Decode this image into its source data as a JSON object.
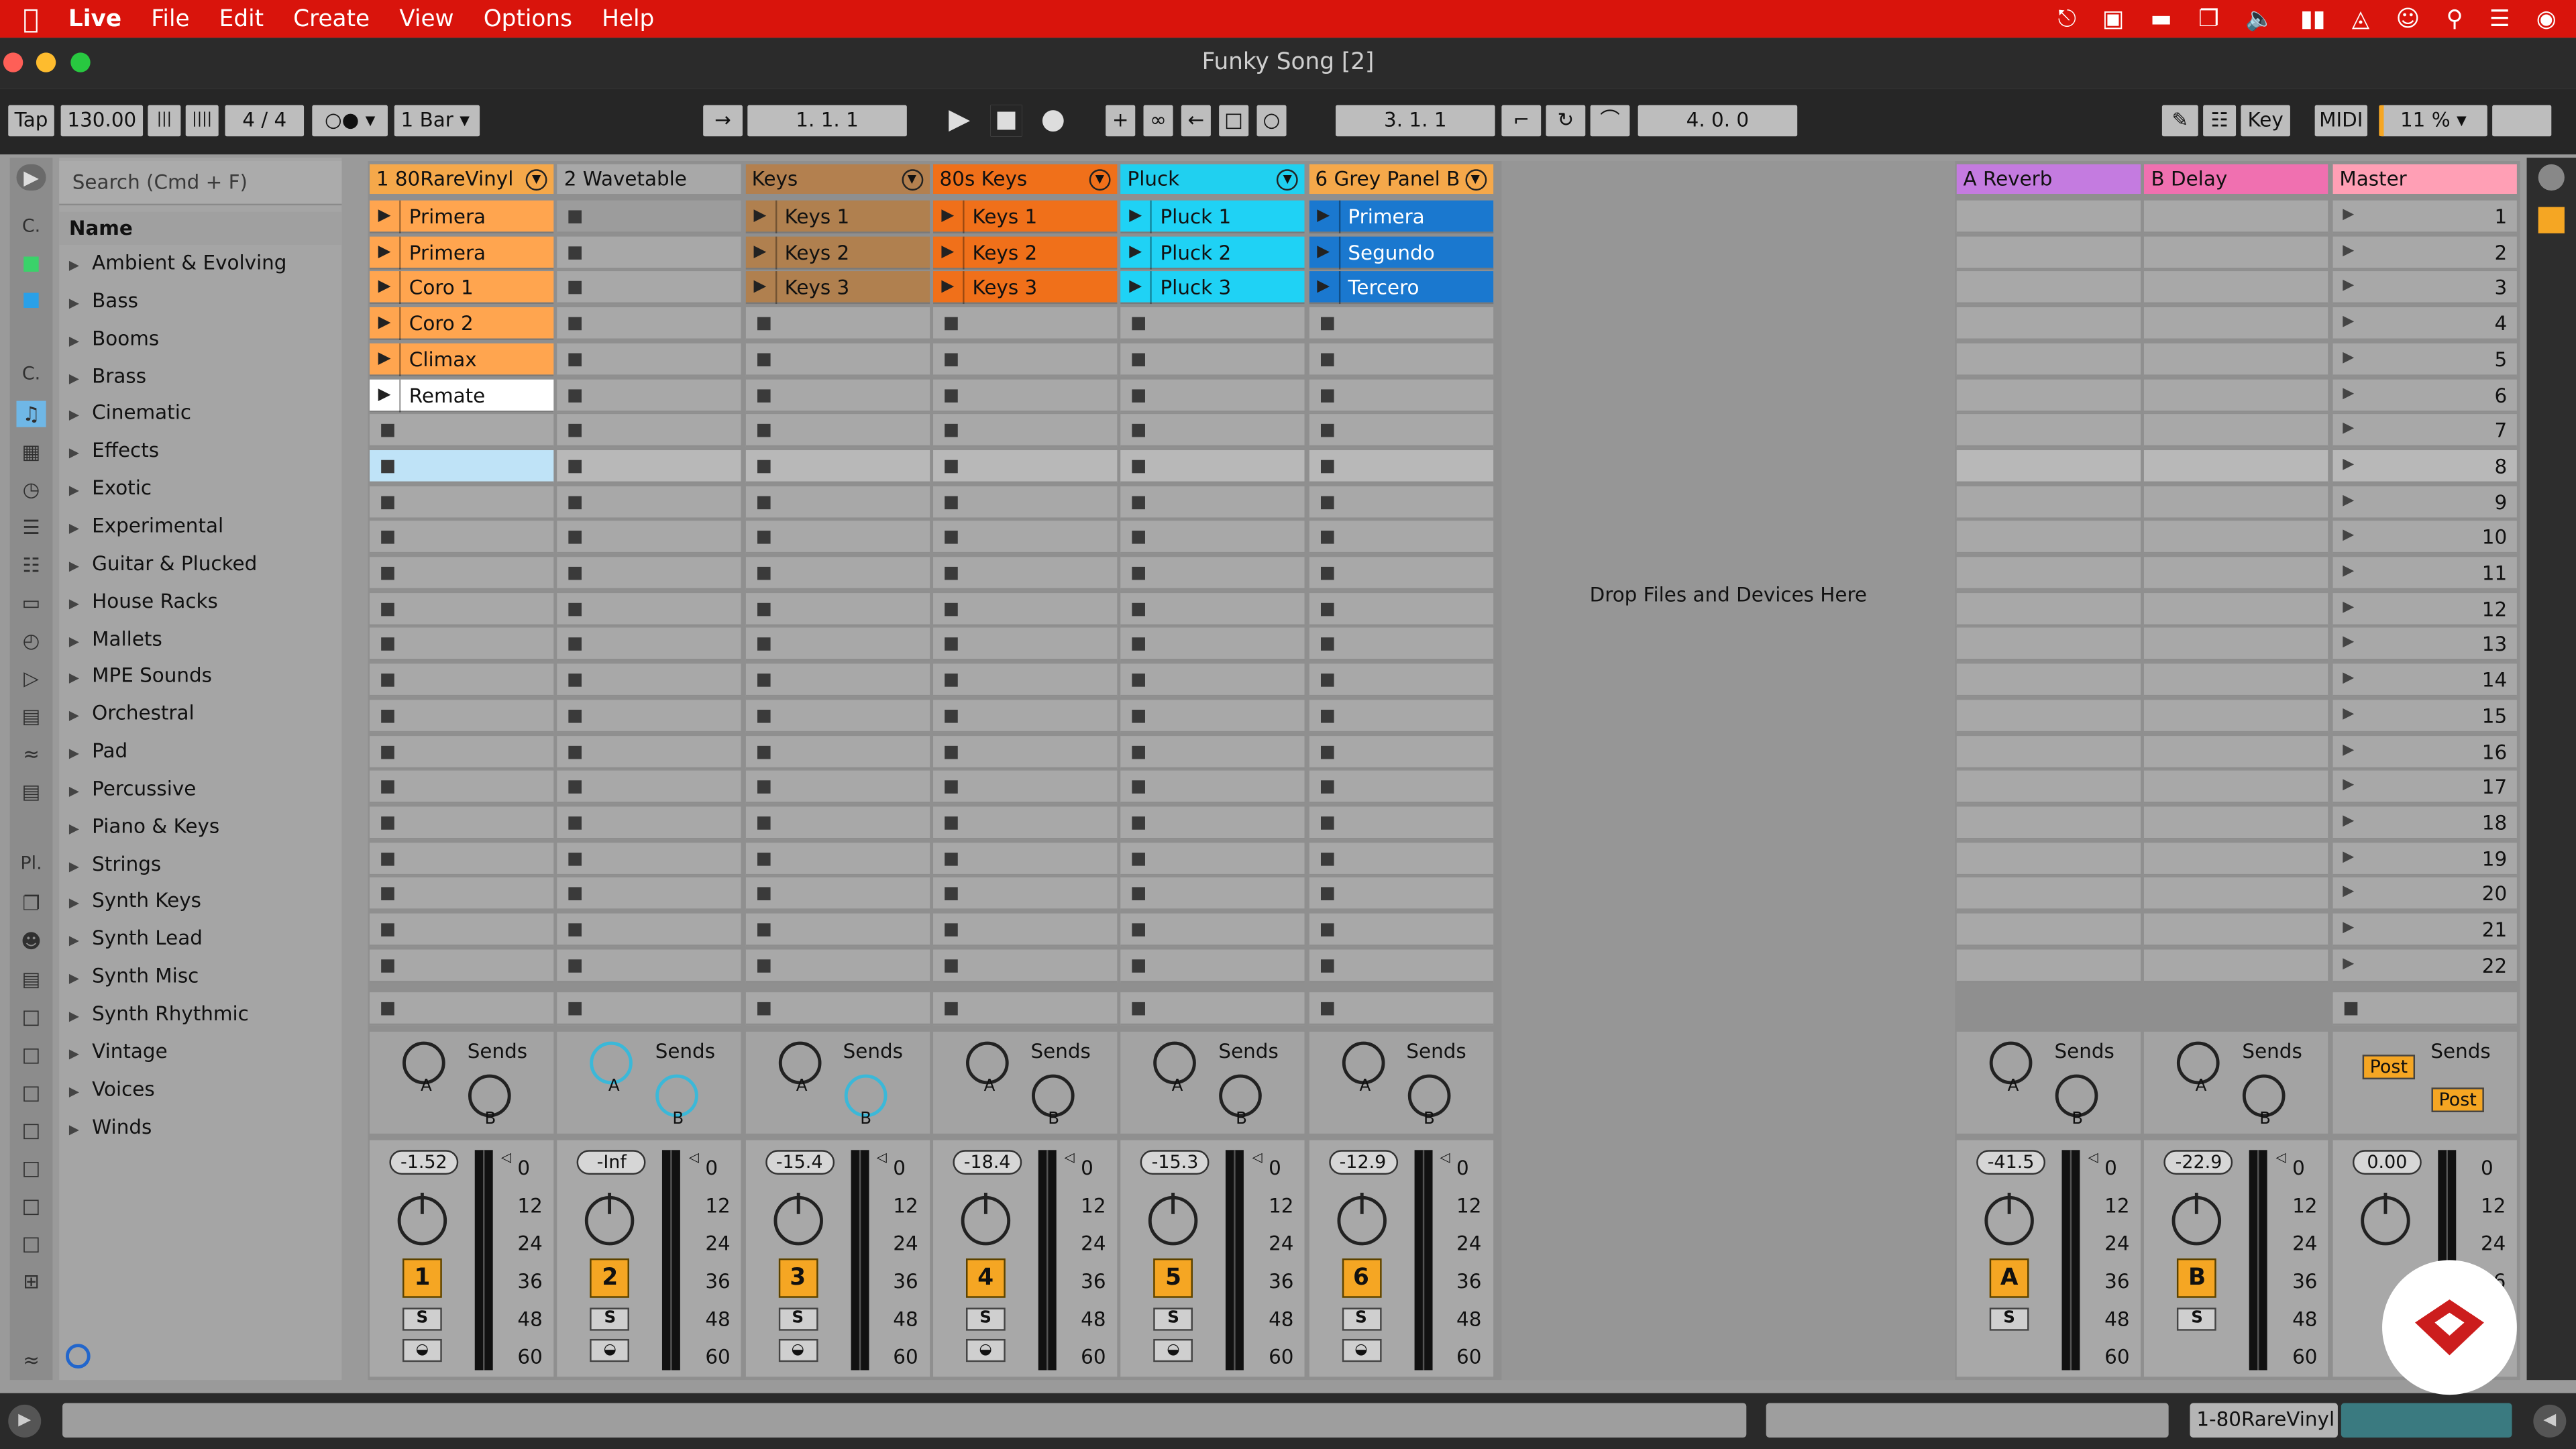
{
  "menubar": {
    "app": "Live",
    "items": [
      "File",
      "Edit",
      "Create",
      "View",
      "Options",
      "Help"
    ]
  },
  "window": {
    "title": "Funky Song  [2]"
  },
  "controlbar": {
    "tap": "Tap",
    "tempo": "130.00",
    "signature": "4 / 4",
    "quantize": "1 Bar",
    "arr_position": "1.   1.   1",
    "loop_start": "3.   1.   1",
    "loop_length": "4.   0.   0",
    "key": "Key",
    "midi": "MIDI",
    "cpu": "11 %"
  },
  "browser": {
    "search_placeholder": "Search (Cmd + F)",
    "name_header": "Name",
    "rail_labels": {
      "collections": "C.",
      "categories": "C.",
      "places": "Pl."
    },
    "items": [
      "Ambient & Evolving",
      "Bass",
      "Booms",
      "Brass",
      "Cinematic",
      "Effects",
      "Exotic",
      "Experimental",
      "Guitar & Plucked",
      "House Racks",
      "Mallets",
      "MPE Sounds",
      "Orchestral",
      "Pad",
      "Percussive",
      "Piano & Keys",
      "Strings",
      "Synth Keys",
      "Synth Lead",
      "Synth Misc",
      "Synth Rhythmic",
      "Vintage",
      "Voices",
      "Winds"
    ]
  },
  "tracks": [
    {
      "name": "1 80RareVinyl",
      "color": "#f5a84a",
      "clips": [
        "Primera",
        "Primera",
        "Coro 1",
        "Coro 2",
        "Climax",
        "Remate"
      ],
      "clip_color": "#ffa54f",
      "volume": "-1.52",
      "number": "1"
    },
    {
      "name": "2 Wavetable",
      "color": "#a8a8a8",
      "clips": [],
      "clip_color": "#a8a8a8",
      "volume": "-Inf",
      "number": "2"
    },
    {
      "name": "Keys",
      "color": "#b3804f",
      "clips": [
        "Keys 1",
        "Keys 2",
        "Keys 3"
      ],
      "clip_color": "#b0804f",
      "volume": "-15.4",
      "number": "3"
    },
    {
      "name": "80s Keys",
      "color": "#f0701a",
      "clips": [
        "Keys 1",
        "Keys 2",
        "Keys 3"
      ],
      "clip_color": "#f0701a",
      "volume": "-18.4",
      "number": "4"
    },
    {
      "name": "Pluck",
      "color": "#20d0f0",
      "clips": [
        "Pluck 1",
        "Pluck 2",
        "Pluck 3"
      ],
      "clip_color": "#1fd2f5",
      "volume": "-15.3",
      "number": "5"
    },
    {
      "name": "6 Grey Panel B",
      "color": "#f5a84a",
      "clips": [
        "Primera",
        "Segundo",
        "Tercero"
      ],
      "clip_color": "#1a78cf",
      "volume": "-12.9",
      "number": "6"
    }
  ],
  "returns": [
    {
      "name": "A Reverb",
      "color": "#c47be0",
      "volume": "-41.5",
      "number": "A"
    },
    {
      "name": "B Delay",
      "color": "#f070b0",
      "volume": "-22.9",
      "number": "B"
    }
  ],
  "master": {
    "name": "Master",
    "color": "#ff9fb5",
    "volume": "0.00",
    "post1": "Post",
    "post2": "Post"
  },
  "scenes": [
    "1",
    "2",
    "3",
    "4",
    "5",
    "6",
    "7",
    "8",
    "9",
    "10",
    "11",
    "12",
    "13",
    "14",
    "15",
    "16",
    "17",
    "18",
    "19",
    "20",
    "21",
    "22"
  ],
  "mixer": {
    "sends": "Sends",
    "send_a": "A",
    "send_b": "B",
    "solo": "S",
    "meter_scale": [
      "0",
      "12",
      "24",
      "36",
      "48",
      "60"
    ]
  },
  "drop_text": "Drop Files and Devices Here",
  "statusbar": {
    "selected_track": "1-80RareVinyl"
  }
}
